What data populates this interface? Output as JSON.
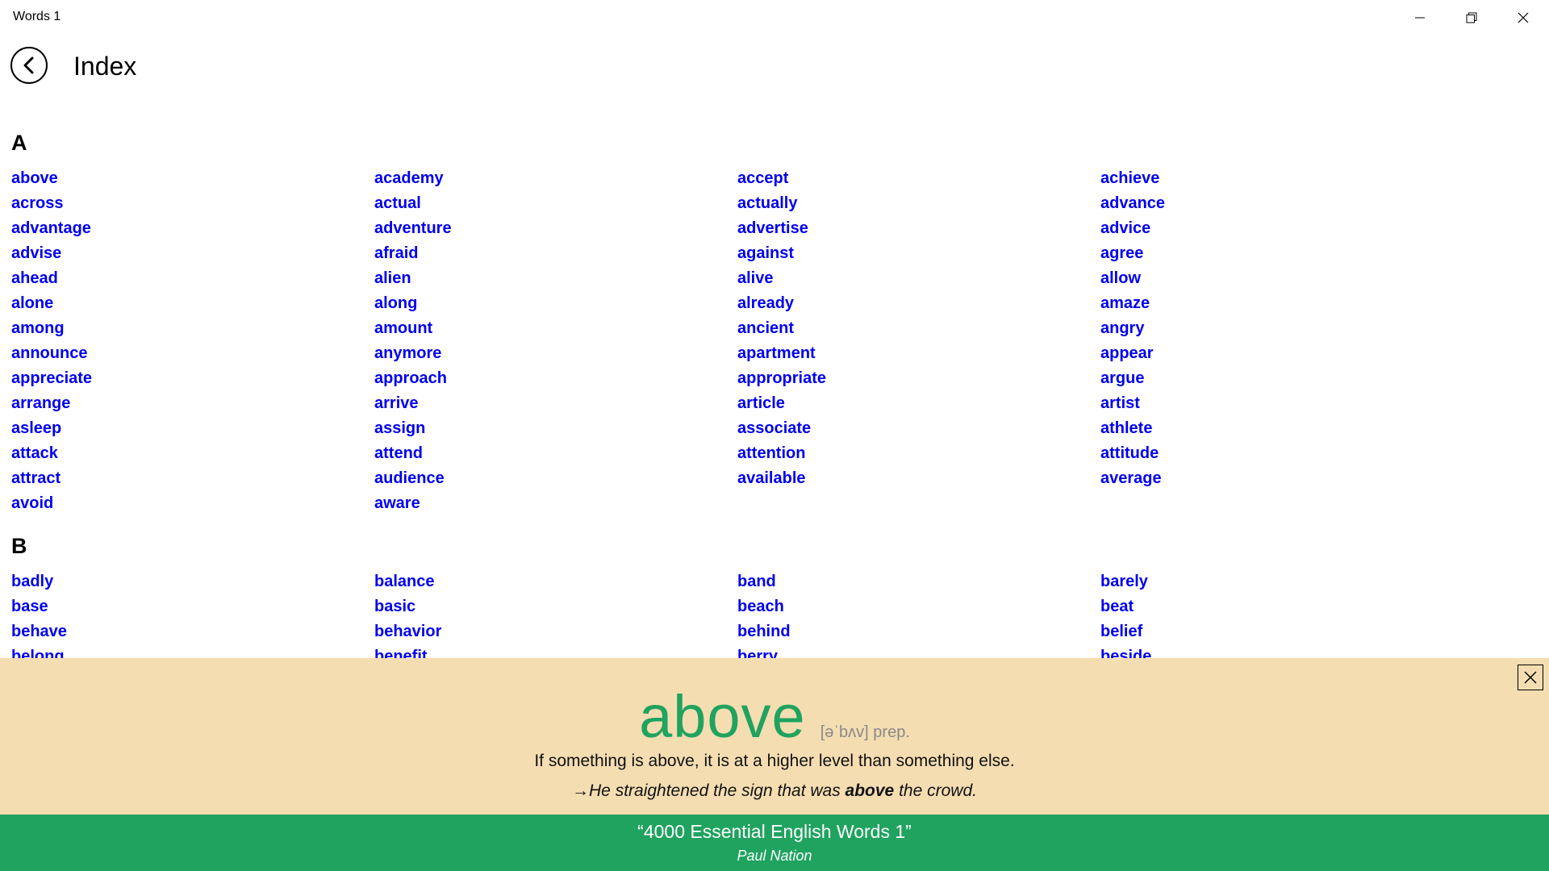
{
  "app": {
    "title": "Words 1"
  },
  "header": {
    "title": "Index"
  },
  "sections": [
    {
      "letter": "A",
      "columns": [
        [
          "above",
          "across",
          "advantage",
          "advise",
          "ahead",
          "alone",
          "among",
          "announce",
          "appreciate",
          "arrange",
          "asleep",
          "attack",
          "attract",
          "avoid"
        ],
        [
          "academy",
          "actual",
          "adventure",
          "afraid",
          "alien",
          "along",
          "amount",
          "anymore",
          "approach",
          "arrive",
          "assign",
          "attend",
          "audience",
          "aware"
        ],
        [
          "accept",
          "actually",
          "advertise",
          "against",
          "alive",
          "already",
          "ancient",
          "apartment",
          "appropriate",
          "article",
          "associate",
          "attention",
          "available"
        ],
        [
          "achieve",
          "advance",
          "advice",
          "agree",
          "allow",
          "amaze",
          "angry",
          "appear",
          "argue",
          "artist",
          "athlete",
          "attitude",
          "average"
        ]
      ]
    },
    {
      "letter": "B",
      "columns": [
        [
          "badly",
          "base",
          "behave",
          "belong"
        ],
        [
          "balance",
          "basic",
          "behavior",
          "benefit"
        ],
        [
          "band",
          "beach",
          "behind",
          "berry"
        ],
        [
          "barely",
          "beat",
          "belief",
          "beside"
        ]
      ]
    }
  ],
  "definition": {
    "word": "above",
    "pronunciation": "[əˈbʌv] prep.",
    "meaning": "If something is above, it is at a higher level than something else.",
    "example_arrow": "→",
    "example_pre": "He straightened the sign that was ",
    "example_bold": "above",
    "example_post": " the crowd."
  },
  "footer": {
    "book_title": "“4000 Essential English Words 1”",
    "author": "Paul Nation"
  },
  "colors": {
    "link": "#0000ee",
    "accent_green": "#1fa35f",
    "panel_bg": "#f5ddb2"
  }
}
